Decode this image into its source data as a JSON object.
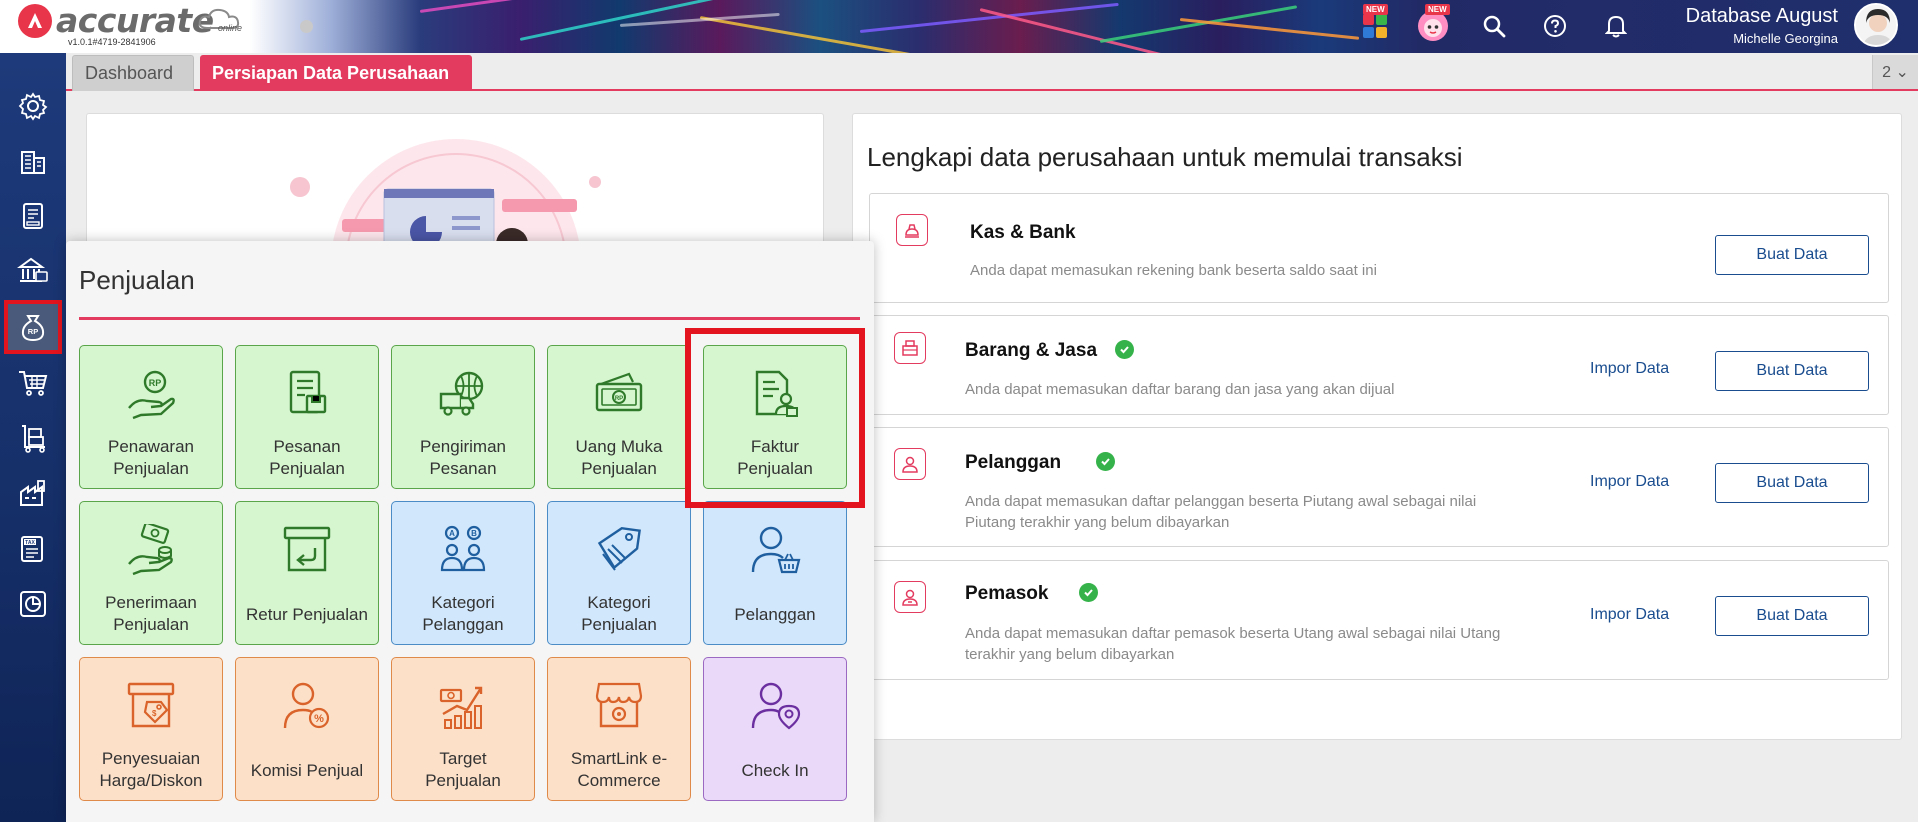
{
  "header": {
    "logo_text": "accurate",
    "logo_sub": "online",
    "version": "v1.0.1#4719-2841906",
    "new_badge_1": "NEW",
    "new_badge_2": "NEW",
    "database_name": "Database August",
    "user_name": "Michelle Georgina"
  },
  "tabs": {
    "dashboard": "Dashboard",
    "persiapan": "Persiapan Data Perusahaan",
    "open_count": "2 ⌄"
  },
  "sidebar": {
    "items": [
      "settings-icon",
      "company-icon",
      "ledger-icon",
      "bank-icon",
      "sales-icon",
      "purchase-icon",
      "inventory-icon",
      "production-icon",
      "tax-icon",
      "report-icon"
    ]
  },
  "setup": {
    "title": "Lengkapi data perusahaan untuk memulai transaksi",
    "import_label": "Impor Data",
    "create_label": "Buat Data",
    "rows": [
      {
        "title": "Kas & Bank",
        "desc": "Anda dapat memasukan rekening bank beserta saldo saat ini",
        "desc2": "",
        "done": false,
        "has_import": false
      },
      {
        "title": "Barang & Jasa",
        "desc": "Anda dapat memasukan daftar barang dan jasa yang akan dijual",
        "desc2": "",
        "done": true,
        "has_import": true
      },
      {
        "title": "Pelanggan",
        "desc": "Anda dapat memasukan daftar pelanggan beserta Piutang awal sebagai nilai",
        "desc2": "Piutang terakhir yang belum dibayarkan",
        "done": true,
        "has_import": true
      },
      {
        "title": "Pemasok",
        "desc": "Anda dapat memasukan daftar pemasok beserta Utang awal sebagai nilai Utang",
        "desc2": "terakhir yang belum dibayarkan",
        "done": true,
        "has_import": true
      }
    ]
  },
  "penjualan": {
    "title": "Penjualan",
    "tiles": [
      {
        "line1": "Penawaran",
        "line2": "Penjualan",
        "color": "green",
        "icon": "quotation-hand-icon"
      },
      {
        "line1": "Pesanan",
        "line2": "Penjualan",
        "color": "green",
        "icon": "sales-order-icon"
      },
      {
        "line1": "Pengiriman",
        "line2": "Pesanan",
        "color": "green",
        "icon": "delivery-truck-icon"
      },
      {
        "line1": "Uang Muka",
        "line2": "Penjualan",
        "color": "green",
        "icon": "down-payment-icon"
      },
      {
        "line1": "Faktur",
        "line2": "Penjualan",
        "color": "green",
        "icon": "sales-invoice-icon"
      },
      {
        "line1": "Penerimaan",
        "line2": "Penjualan",
        "color": "green",
        "icon": "receipt-hand-icon"
      },
      {
        "line1": "Retur Penjualan",
        "line2": "",
        "color": "green",
        "icon": "sales-return-icon"
      },
      {
        "line1": "Kategori",
        "line2": "Pelanggan",
        "color": "blue",
        "icon": "customer-category-icon"
      },
      {
        "line1": "Kategori",
        "line2": "Penjualan",
        "color": "blue",
        "icon": "sales-category-icon"
      },
      {
        "line1": "Pelanggan",
        "line2": "",
        "color": "blue",
        "icon": "customer-icon"
      },
      {
        "line1": "Penyesuaian",
        "line2": "Harga/Diskon",
        "color": "orange",
        "icon": "price-adjustment-icon"
      },
      {
        "line1": "Komisi Penjual",
        "line2": "",
        "color": "orange",
        "icon": "commission-icon"
      },
      {
        "line1": "Target",
        "line2": "Penjualan",
        "color": "orange",
        "icon": "sales-target-icon"
      },
      {
        "line1": "SmartLink e-",
        "line2": "Commerce",
        "color": "orange",
        "icon": "ecommerce-store-icon"
      },
      {
        "line1": "Check In",
        "line2": "",
        "color": "purple",
        "icon": "check-in-icon"
      }
    ]
  },
  "colors": {
    "accent": "#e33b5f",
    "green_icon": "#2f7a2a",
    "blue_icon": "#1f5fa0",
    "orange_icon": "#d9632a",
    "purple_icon": "#6b2fa0",
    "link": "#1a4d8f"
  }
}
